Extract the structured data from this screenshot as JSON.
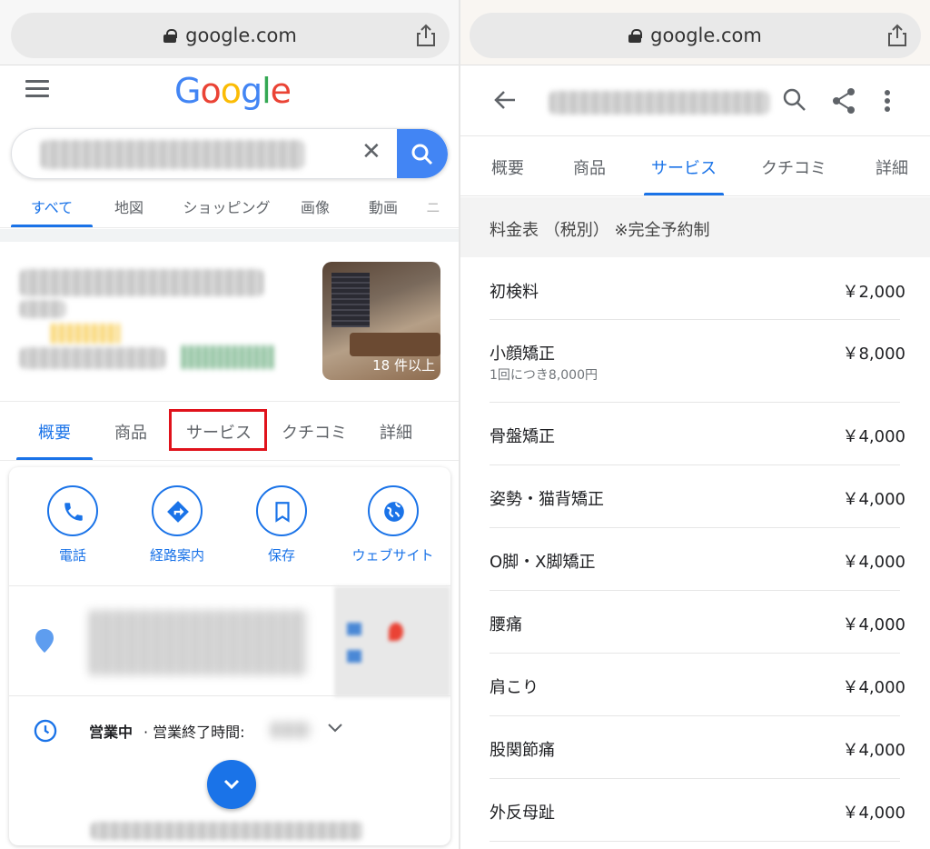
{
  "browser": {
    "url": "google.com"
  },
  "left": {
    "logo": [
      "G",
      "o",
      "o",
      "g",
      "l",
      "e"
    ],
    "logo_colors": [
      "#4285f4",
      "#ea4335",
      "#fbbc05",
      "#4285f4",
      "#34a853",
      "#ea4335"
    ],
    "clear_label": "✕",
    "tabs": [
      "すべて",
      "地図",
      "ショッピング",
      "画像",
      "動画",
      "ニ"
    ],
    "photo_caption": "18 件以上",
    "knowledge_tabs": [
      "概要",
      "商品",
      "サービス",
      "クチコミ",
      "詳細"
    ],
    "actions": [
      "電話",
      "経路案内",
      "保存",
      "ウェブサイト"
    ],
    "hours_status": "営業中",
    "hours_text": " · 営業終了時間: "
  },
  "right": {
    "tabs": [
      "概要",
      "商品",
      "サービス",
      "クチコミ",
      "詳細"
    ],
    "section_title": "料金表 （税別） ※完全予約制",
    "prices": [
      {
        "name": "初検料",
        "price": "￥2,000",
        "note": ""
      },
      {
        "name": "小顔矯正",
        "price": "￥8,000",
        "note": "1回につき8,000円"
      },
      {
        "name": "骨盤矯正",
        "price": "￥4,000",
        "note": ""
      },
      {
        "name": "姿勢・猫背矯正",
        "price": "￥4,000",
        "note": ""
      },
      {
        "name": "O脚・X脚矯正",
        "price": "￥4,000",
        "note": ""
      },
      {
        "name": "腰痛",
        "price": "￥4,000",
        "note": ""
      },
      {
        "name": "肩こり",
        "price": "￥4,000",
        "note": ""
      },
      {
        "name": "股関節痛",
        "price": "￥4,000",
        "note": ""
      },
      {
        "name": "外反母趾",
        "price": "￥4,000",
        "note": ""
      }
    ]
  },
  "colors": {
    "accent": "#1a73e8",
    "highlight_box": "#e0121b"
  }
}
